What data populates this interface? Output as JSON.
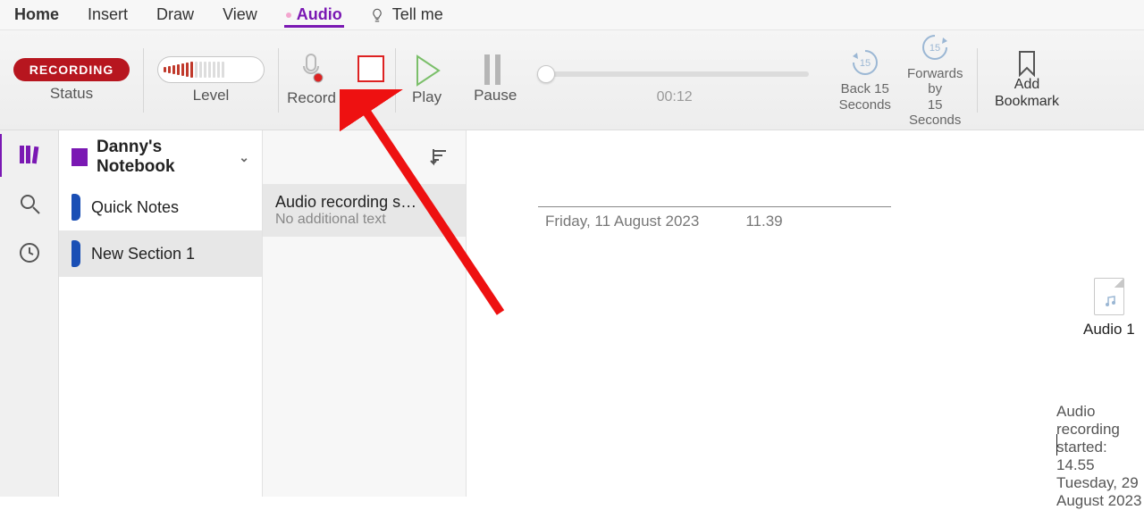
{
  "menu": {
    "home": "Home",
    "insert": "Insert",
    "draw": "Draw",
    "view": "View",
    "audio": "Audio",
    "tell_me": "Tell me"
  },
  "ribbon": {
    "status_badge": "RECORDING",
    "status_label": "Status",
    "level_label": "Level",
    "record": "Record",
    "stop": "Stop",
    "play": "Play",
    "pause": "Pause",
    "time": "00:12",
    "back15_line1": "Back 15",
    "back15_line2": "Seconds",
    "fwd15_line1": "Forwards by",
    "fwd15_line2": "15 Seconds",
    "bookmark_line1": "Add",
    "bookmark_line2": "Bookmark",
    "skip_number": "15"
  },
  "notebook": {
    "name": "Danny's Notebook",
    "sections": [
      {
        "label": "Quick Notes"
      },
      {
        "label": "New Section 1"
      }
    ]
  },
  "pages": [
    {
      "title": "Audio recording s…",
      "subtitle": "No additional text"
    }
  ],
  "note": {
    "date": "Friday, 11 August 2023",
    "time": "11.39",
    "audio_name": "Audio 1",
    "recording_meta": "Audio recording started: 14.55 Tuesday, 29 August 2023"
  },
  "colors": {
    "accent": "#7a18b3",
    "recording": "#b7161f"
  }
}
